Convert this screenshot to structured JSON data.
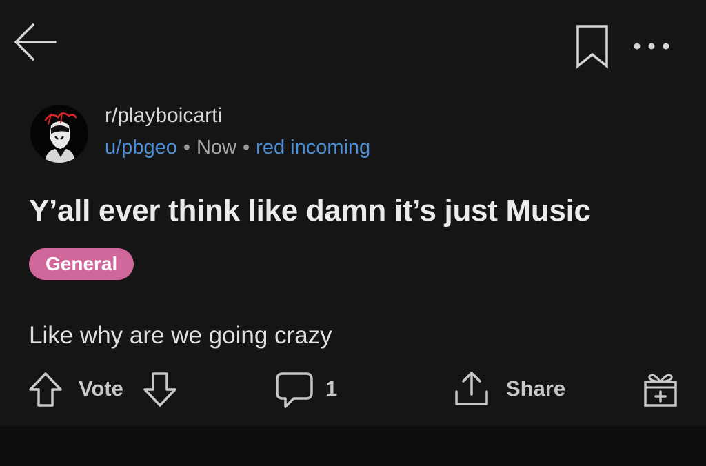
{
  "header": {
    "back_icon": "back-arrow-icon",
    "save_icon": "bookmark-icon",
    "more_icon": "more-options-icon"
  },
  "post": {
    "subreddit": "r/playboicarti",
    "author": "u/pbgeo",
    "separator": "•",
    "time": "Now",
    "author_flair": "red incoming",
    "title": "Y’all ever think like damn it’s just Music",
    "flair": "General",
    "body": "Like why are we going crazy"
  },
  "actions": {
    "upvote_icon": "upvote-arrow-icon",
    "vote_label": "Vote",
    "downvote_icon": "downvote-arrow-icon",
    "comment_icon": "comment-bubble-icon",
    "comment_count": "1",
    "share_icon": "share-icon",
    "share_label": "Share",
    "award_icon": "gift-award-icon"
  },
  "colors": {
    "background": "#151515",
    "text": "#e6e6e6",
    "link_blue": "#4d8fd6",
    "flair_pink": "#d0679a",
    "icon_gray": "#c8c8c8"
  }
}
